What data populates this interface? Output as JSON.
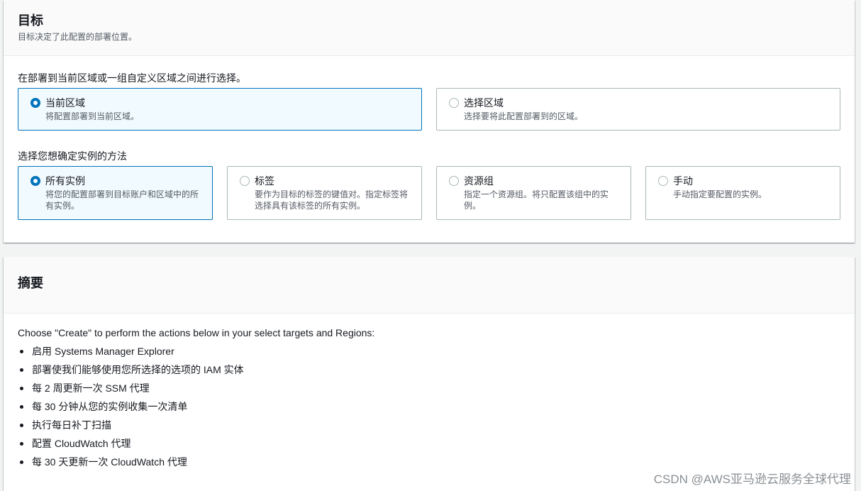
{
  "target": {
    "title": "目标",
    "description": "目标决定了此配置的部署位置。",
    "region_question": "在部署到当前区域或一组自定义区域之间进行选择。",
    "region_options": [
      {
        "title": "当前区域",
        "description": "将配置部署到当前区域。",
        "selected": true
      },
      {
        "title": "选择区域",
        "description": "选择要将此配置部署到的区域。",
        "selected": false
      }
    ],
    "instance_question": "选择您想确定实例的方法",
    "instance_options": [
      {
        "title": "所有实例",
        "description": "将您的配置部署到目标账户和区域中的所有实例。",
        "selected": true
      },
      {
        "title": "标签",
        "description": "要作为目标的标签的键值对。指定标签将选择具有该标签的所有实例。",
        "selected": false
      },
      {
        "title": "资源组",
        "description": "指定一个资源组。将只配置该组中的实例。",
        "selected": false
      },
      {
        "title": "手动",
        "description": "手动指定要配置的实例。",
        "selected": false
      }
    ]
  },
  "summary": {
    "title": "摘要",
    "intro": "Choose \"Create\" to perform the actions below in your select targets and Regions:",
    "items": [
      "启用 Systems Manager Explorer",
      "部署使我们能够使用您所选择的选项的 IAM 实体",
      "每 2 周更新一次 SSM 代理",
      "每 30 分钟从您的实例收集一次清单",
      "执行每日补丁扫描",
      "配置 CloudWatch 代理",
      "每 30 天更新一次 CloudWatch 代理"
    ]
  },
  "watermark": "CSDN @AWS亚马逊云服务全球代理",
  "colors": {
    "accent": "#0073bb",
    "selected_bg": "#f1faff",
    "border": "#aab7b8"
  }
}
